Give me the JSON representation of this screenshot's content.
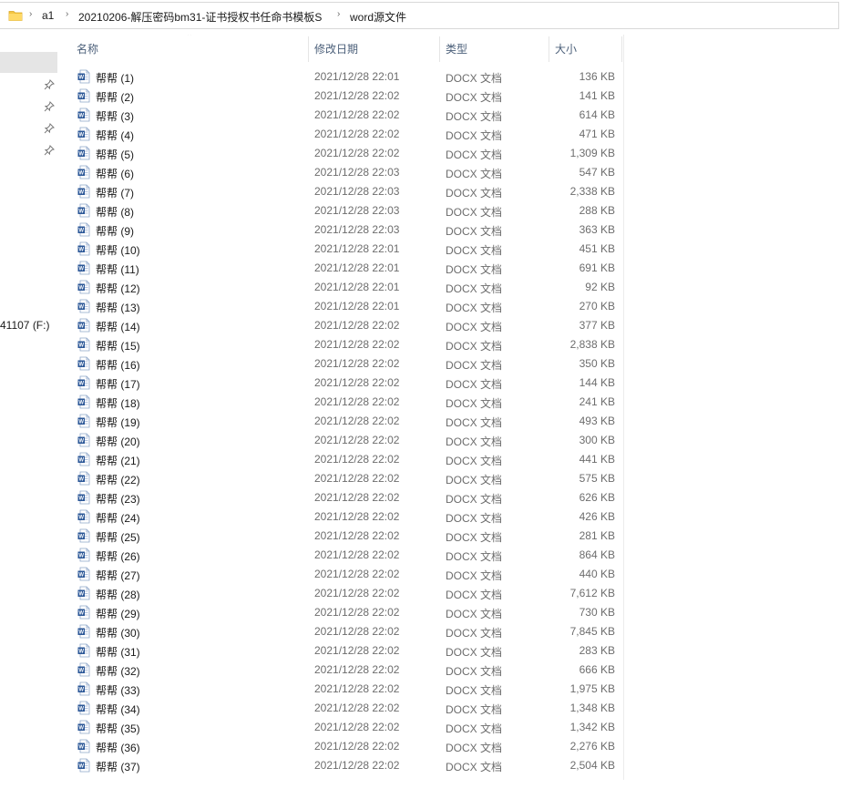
{
  "breadcrumb": {
    "items": [
      "a1",
      "20210206-解压密码bm31-证书授权书任命书模板S",
      "word源文件"
    ]
  },
  "nav": {
    "drive_label": "41107 (F:)"
  },
  "columns": {
    "name": "名称",
    "date": "修改日期",
    "type": "类型",
    "size": "大小"
  },
  "files": [
    {
      "name": "帮帮 (1)",
      "date": "2021/12/28 22:01",
      "type": "DOCX 文档",
      "size": "136 KB"
    },
    {
      "name": "帮帮 (2)",
      "date": "2021/12/28 22:02",
      "type": "DOCX 文档",
      "size": "141 KB"
    },
    {
      "name": "帮帮 (3)",
      "date": "2021/12/28 22:02",
      "type": "DOCX 文档",
      "size": "614 KB"
    },
    {
      "name": "帮帮 (4)",
      "date": "2021/12/28 22:02",
      "type": "DOCX 文档",
      "size": "471 KB"
    },
    {
      "name": "帮帮 (5)",
      "date": "2021/12/28 22:02",
      "type": "DOCX 文档",
      "size": "1,309 KB"
    },
    {
      "name": "帮帮 (6)",
      "date": "2021/12/28 22:03",
      "type": "DOCX 文档",
      "size": "547 KB"
    },
    {
      "name": "帮帮 (7)",
      "date": "2021/12/28 22:03",
      "type": "DOCX 文档",
      "size": "2,338 KB"
    },
    {
      "name": "帮帮 (8)",
      "date": "2021/12/28 22:03",
      "type": "DOCX 文档",
      "size": "288 KB"
    },
    {
      "name": "帮帮 (9)",
      "date": "2021/12/28 22:03",
      "type": "DOCX 文档",
      "size": "363 KB"
    },
    {
      "name": "帮帮 (10)",
      "date": "2021/12/28 22:01",
      "type": "DOCX 文档",
      "size": "451 KB"
    },
    {
      "name": "帮帮 (11)",
      "date": "2021/12/28 22:01",
      "type": "DOCX 文档",
      "size": "691 KB"
    },
    {
      "name": "帮帮 (12)",
      "date": "2021/12/28 22:01",
      "type": "DOCX 文档",
      "size": "92 KB"
    },
    {
      "name": "帮帮 (13)",
      "date": "2021/12/28 22:01",
      "type": "DOCX 文档",
      "size": "270 KB"
    },
    {
      "name": "帮帮 (14)",
      "date": "2021/12/28 22:02",
      "type": "DOCX 文档",
      "size": "377 KB"
    },
    {
      "name": "帮帮 (15)",
      "date": "2021/12/28 22:02",
      "type": "DOCX 文档",
      "size": "2,838 KB"
    },
    {
      "name": "帮帮 (16)",
      "date": "2021/12/28 22:02",
      "type": "DOCX 文档",
      "size": "350 KB"
    },
    {
      "name": "帮帮 (17)",
      "date": "2021/12/28 22:02",
      "type": "DOCX 文档",
      "size": "144 KB"
    },
    {
      "name": "帮帮 (18)",
      "date": "2021/12/28 22:02",
      "type": "DOCX 文档",
      "size": "241 KB"
    },
    {
      "name": "帮帮 (19)",
      "date": "2021/12/28 22:02",
      "type": "DOCX 文档",
      "size": "493 KB"
    },
    {
      "name": "帮帮 (20)",
      "date": "2021/12/28 22:02",
      "type": "DOCX 文档",
      "size": "300 KB"
    },
    {
      "name": "帮帮 (21)",
      "date": "2021/12/28 22:02",
      "type": "DOCX 文档",
      "size": "441 KB"
    },
    {
      "name": "帮帮 (22)",
      "date": "2021/12/28 22:02",
      "type": "DOCX 文档",
      "size": "575 KB"
    },
    {
      "name": "帮帮 (23)",
      "date": "2021/12/28 22:02",
      "type": "DOCX 文档",
      "size": "626 KB"
    },
    {
      "name": "帮帮 (24)",
      "date": "2021/12/28 22:02",
      "type": "DOCX 文档",
      "size": "426 KB"
    },
    {
      "name": "帮帮 (25)",
      "date": "2021/12/28 22:02",
      "type": "DOCX 文档",
      "size": "281 KB"
    },
    {
      "name": "帮帮 (26)",
      "date": "2021/12/28 22:02",
      "type": "DOCX 文档",
      "size": "864 KB"
    },
    {
      "name": "帮帮 (27)",
      "date": "2021/12/28 22:02",
      "type": "DOCX 文档",
      "size": "440 KB"
    },
    {
      "name": "帮帮 (28)",
      "date": "2021/12/28 22:02",
      "type": "DOCX 文档",
      "size": "7,612 KB"
    },
    {
      "name": "帮帮 (29)",
      "date": "2021/12/28 22:02",
      "type": "DOCX 文档",
      "size": "730 KB"
    },
    {
      "name": "帮帮 (30)",
      "date": "2021/12/28 22:02",
      "type": "DOCX 文档",
      "size": "7,845 KB"
    },
    {
      "name": "帮帮 (31)",
      "date": "2021/12/28 22:02",
      "type": "DOCX 文档",
      "size": "283 KB"
    },
    {
      "name": "帮帮 (32)",
      "date": "2021/12/28 22:02",
      "type": "DOCX 文档",
      "size": "666 KB"
    },
    {
      "name": "帮帮 (33)",
      "date": "2021/12/28 22:02",
      "type": "DOCX 文档",
      "size": "1,975 KB"
    },
    {
      "name": "帮帮 (34)",
      "date": "2021/12/28 22:02",
      "type": "DOCX 文档",
      "size": "1,348 KB"
    },
    {
      "name": "帮帮 (35)",
      "date": "2021/12/28 22:02",
      "type": "DOCX 文档",
      "size": "1,342 KB"
    },
    {
      "name": "帮帮 (36)",
      "date": "2021/12/28 22:02",
      "type": "DOCX 文档",
      "size": "2,276 KB"
    },
    {
      "name": "帮帮 (37)",
      "date": "2021/12/28 22:02",
      "type": "DOCX 文档",
      "size": "2,504 KB"
    }
  ],
  "colors": {
    "header_text": "#4c607a",
    "meta_text": "#6d6d6d",
    "nav_selected_bg": "#e5e5e5",
    "word_icon_blue": "#2b5797",
    "folder_yellow": "#f4c542"
  }
}
